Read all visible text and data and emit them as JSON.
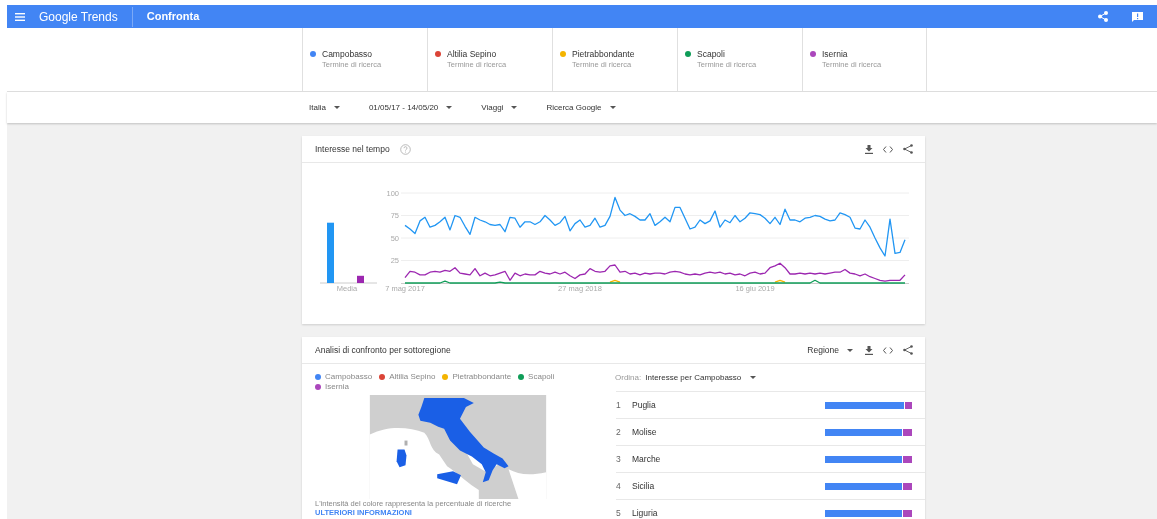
{
  "header": {
    "product": "Google Trends",
    "page": "Confronta"
  },
  "terms": [
    {
      "name": "Campobasso",
      "subtitle": "Termine di ricerca",
      "color": "#4285f4"
    },
    {
      "name": "Altilia Sepino",
      "subtitle": "Termine di ricerca",
      "color": "#db4437"
    },
    {
      "name": "Pietrabbondante",
      "subtitle": "Termine di ricerca",
      "color": "#f4b400"
    },
    {
      "name": "Scapoli",
      "subtitle": "Termine di ricerca",
      "color": "#0f9d58"
    },
    {
      "name": "Isernia",
      "subtitle": "Termine di ricerca",
      "color": "#ab47bc"
    }
  ],
  "filters": [
    {
      "label": "Italia"
    },
    {
      "label": "01/05/17 - 14/05/20"
    },
    {
      "label": "Viaggi"
    },
    {
      "label": "Ricerca Google"
    }
  ],
  "interest_over_time": {
    "title": "Interesse nel tempo",
    "averages": {
      "chart_data": {
        "type": "bar",
        "categories": [
          "Media"
        ],
        "ylim": [
          0,
          100
        ],
        "series": [
          {
            "color": "#2196f3",
            "values": [
              67
            ]
          },
          {
            "color": "#9c27b0",
            "values": [
              8
            ]
          }
        ]
      }
    },
    "chart_data": {
      "type": "line",
      "grid": true,
      "ylim": [
        0,
        100
      ],
      "yticks": [
        25,
        50,
        75,
        100
      ],
      "categories": [
        "7 mag 2017",
        null,
        null,
        null,
        null,
        null,
        null,
        null,
        null,
        null,
        null,
        null,
        null,
        null,
        null,
        null,
        null,
        null,
        null,
        null,
        null,
        null,
        null,
        null,
        null,
        null,
        null,
        null,
        null,
        null,
        null,
        null,
        null,
        null,
        null,
        "27 mag 2018",
        null,
        null,
        null,
        null,
        null,
        null,
        null,
        null,
        null,
        null,
        null,
        null,
        null,
        null,
        null,
        null,
        null,
        null,
        null,
        null,
        null,
        null,
        null,
        null,
        null,
        null,
        null,
        null,
        null,
        null,
        null,
        null,
        null,
        null,
        "16 giu 2019",
        null,
        null,
        null,
        null,
        null,
        null,
        null,
        null,
        null,
        null,
        null,
        null,
        null,
        null,
        null,
        null,
        null,
        null,
        null,
        null,
        null,
        null,
        null,
        null,
        null,
        null,
        null,
        null,
        null,
        null
      ],
      "series": [
        {
          "color": "#2196f3",
          "values": [
            64,
            60,
            55,
            69,
            73,
            62,
            64,
            68,
            73,
            59,
            75,
            73,
            63,
            54,
            73,
            70,
            68,
            65,
            64,
            65,
            57,
            73,
            72,
            62,
            68,
            68,
            65,
            68,
            75,
            70,
            64,
            67,
            74,
            58,
            66,
            70,
            62,
            64,
            72,
            62,
            64,
            74,
            95,
            81,
            75,
            77,
            74,
            70,
            70,
            77,
            64,
            68,
            73,
            68,
            84,
            84,
            72,
            60,
            62,
            70,
            66,
            69,
            80,
            62,
            70,
            67,
            75,
            68,
            72,
            78,
            77,
            76,
            72,
            66,
            73,
            65,
            82,
            70,
            70,
            68,
            72,
            73,
            75,
            74,
            71,
            69,
            70,
            78,
            76,
            73,
            61,
            60,
            70,
            62,
            50,
            39,
            30,
            71,
            33,
            34,
            48
          ]
        },
        {
          "color": "#f4b400",
          "values": [
            null,
            null,
            null,
            null,
            null,
            null,
            null,
            null,
            null,
            null,
            null,
            null,
            null,
            null,
            null,
            null,
            null,
            null,
            null,
            null,
            null,
            null,
            null,
            null,
            null,
            null,
            null,
            null,
            null,
            null,
            null,
            null,
            null,
            null,
            null,
            null,
            null,
            null,
            null,
            null,
            null,
            1,
            3,
            1,
            null,
            null,
            null,
            null,
            null,
            null,
            null,
            null,
            null,
            null,
            null,
            null,
            null,
            null,
            null,
            null,
            null,
            null,
            null,
            null,
            null,
            null,
            null,
            null,
            null,
            null,
            null,
            null,
            null,
            null,
            1,
            3,
            1,
            null,
            null,
            null,
            null,
            null,
            null,
            null,
            null,
            null,
            null,
            null,
            null,
            null,
            null,
            null,
            null,
            null,
            null,
            null,
            null,
            null,
            null,
            null,
            null
          ]
        },
        {
          "color": "#0f9d58",
          "values": [
            0,
            0,
            0,
            0,
            0,
            0,
            0,
            0,
            2,
            0,
            0,
            0,
            0,
            0,
            0,
            0,
            0,
            0,
            0,
            1,
            0,
            0,
            0,
            0,
            0,
            0,
            0,
            0,
            0,
            0,
            0,
            0,
            0,
            0,
            0,
            0,
            0,
            0,
            0,
            0,
            0,
            0,
            0,
            0,
            0,
            0,
            0,
            0,
            0,
            0,
            0,
            0,
            0,
            0,
            0,
            0,
            0,
            0,
            0,
            0,
            0,
            0,
            0,
            0,
            0,
            0,
            0,
            0,
            0,
            0,
            0,
            0,
            0,
            0,
            0,
            0,
            0,
            0,
            0,
            0,
            0,
            0,
            3,
            0,
            0,
            0,
            0,
            0,
            0,
            0,
            0,
            0,
            0,
            0,
            0,
            0,
            0,
            0,
            0,
            0,
            0
          ]
        },
        {
          "color": "#9c27b0",
          "values": [
            6,
            13,
            12,
            9,
            9,
            12,
            13,
            12,
            14,
            13,
            17,
            11,
            10,
            9,
            16,
            8,
            11,
            8,
            9,
            11,
            13,
            3,
            11,
            8,
            10,
            9,
            9,
            13,
            11,
            10,
            12,
            10,
            12,
            8,
            5,
            9,
            10,
            16,
            13,
            12,
            13,
            19,
            20,
            12,
            13,
            10,
            11,
            9,
            11,
            10,
            11,
            11,
            10,
            12,
            13,
            12,
            10,
            9,
            10,
            9,
            11,
            12,
            11,
            12,
            10,
            11,
            9,
            10,
            8,
            11,
            12,
            10,
            11,
            17,
            19,
            22,
            17,
            10,
            10,
            11,
            10,
            11,
            10,
            11,
            10,
            11,
            12,
            12,
            15,
            11,
            10,
            8,
            10,
            7,
            5,
            3,
            2,
            3,
            3,
            3,
            9
          ]
        }
      ]
    }
  },
  "subregion": {
    "title": "Analisi di confronto per sottoregione",
    "dropdown": "Regione",
    "legend": [
      {
        "name": "Campobasso",
        "color": "#4285f4"
      },
      {
        "name": "Altilia Sepino",
        "color": "#db4437"
      },
      {
        "name": "Pietrabbondante",
        "color": "#f4b400"
      },
      {
        "name": "Scapoli",
        "color": "#0f9d58"
      },
      {
        "name": "Isernia",
        "color": "#ab47bc"
      }
    ],
    "note": "L'intensità del colore rappresenta la percentuale di ricerche",
    "link": "ULTERIORI INFORMAZIONI",
    "sort_label": "Ordina:",
    "sort_value": "Interesse per Campobasso",
    "rows": [
      {
        "rank": "1",
        "name": "Puglia",
        "segments": [
          {
            "color": "#4285f4",
            "level": 0.91
          },
          {
            "color": "#ab47bc"
          }
        ]
      },
      {
        "rank": "2",
        "name": "Molise",
        "segments": [
          {
            "color": "#4285f4",
            "level": 0.89
          },
          {
            "color": "#ab47bc"
          }
        ]
      },
      {
        "rank": "3",
        "name": "Marche",
        "segments": [
          {
            "color": "#4285f4",
            "level": 0.89
          },
          {
            "color": "#ab47bc"
          }
        ]
      },
      {
        "rank": "4",
        "name": "Sicilia",
        "segments": [
          {
            "color": "#4285f4",
            "level": 0.89
          },
          {
            "color": "#ab47bc"
          }
        ]
      },
      {
        "rank": "5",
        "name": "Liguria",
        "segments": [
          {
            "color": "#4285f4",
            "level": 0.89
          },
          {
            "color": "#ab47bc"
          }
        ]
      }
    ]
  }
}
